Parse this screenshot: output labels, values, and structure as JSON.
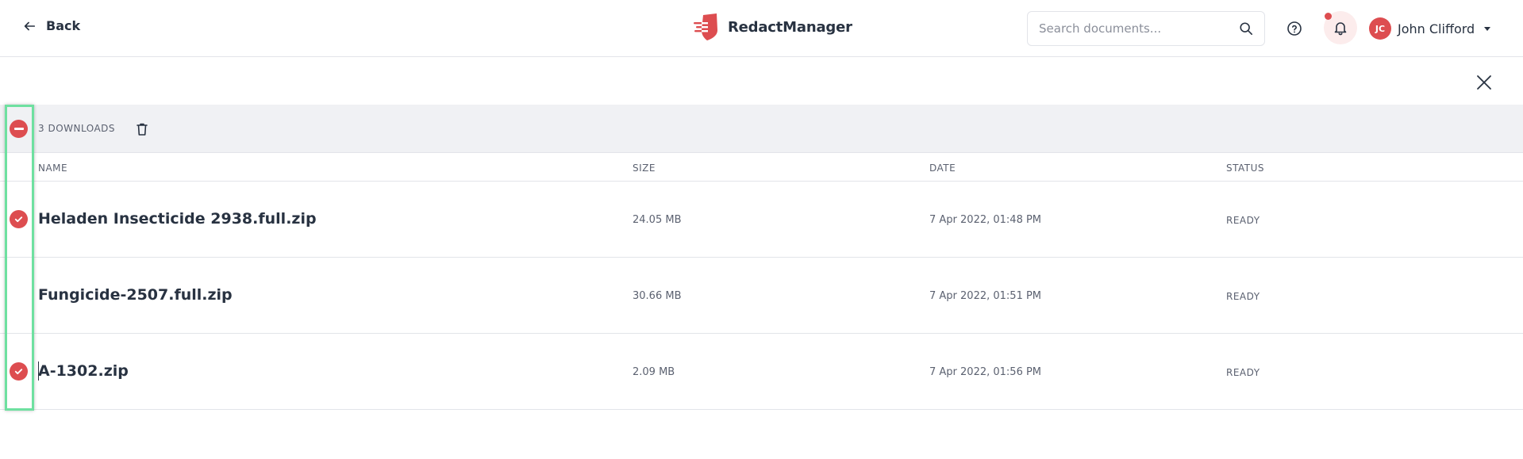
{
  "header": {
    "back_label": "Back",
    "brand": "RedactManager",
    "search_placeholder": "Search documents...",
    "user_initials": "JC",
    "user_name": "John Clifford",
    "accent_color": "#dd4d50"
  },
  "bulk": {
    "count_label": "3 DOWNLOADS"
  },
  "table": {
    "columns": [
      "NAME",
      "SIZE",
      "DATE",
      "STATUS"
    ],
    "rows": [
      {
        "name": "Heladen Insecticide 2938.full.zip",
        "size": "24.05 MB",
        "date": "7 Apr 2022, 01:48 PM",
        "status": "READY",
        "selected": true
      },
      {
        "name": "Fungicide-2507.full.zip",
        "size": "30.66 MB",
        "date": "7 Apr 2022, 01:51 PM",
        "status": "READY",
        "selected": false
      },
      {
        "name": "A-1302.zip",
        "size": "2.09 MB",
        "date": "7 Apr 2022, 01:56 PM",
        "status": "READY",
        "selected": true
      }
    ]
  }
}
